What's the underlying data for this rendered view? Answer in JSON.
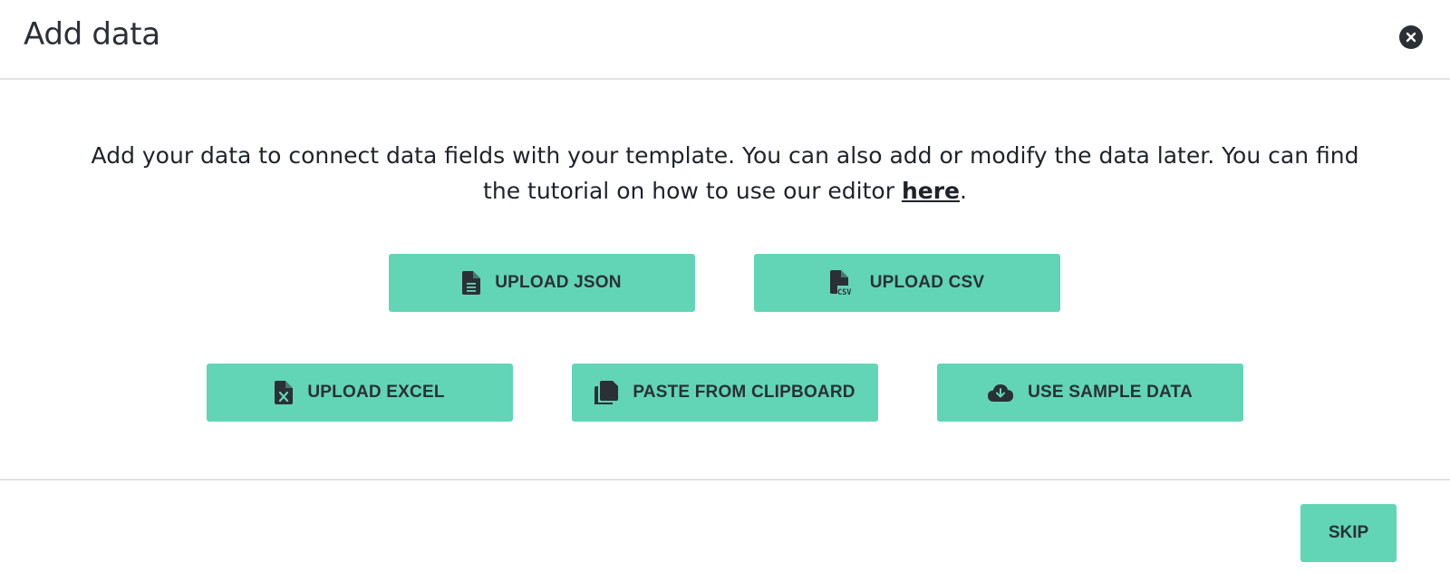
{
  "dialog": {
    "title": "Add data",
    "close_icon": "close-icon"
  },
  "description": {
    "text": "Add your data to connect data fields with your template. You can also add or modify the data later. You can find the tutorial on how to use our editor ",
    "link_text": "here",
    "suffix": "."
  },
  "buttons": {
    "upload_json": {
      "label": "UPLOAD JSON",
      "icon": "file-json-icon"
    },
    "upload_csv": {
      "label": "UPLOAD CSV",
      "icon": "file-csv-icon"
    },
    "upload_excel": {
      "label": "UPLOAD EXCEL",
      "icon": "file-excel-icon"
    },
    "paste_clipboard": {
      "label": "PASTE FROM CLIPBOARD",
      "icon": "clipboard-icon"
    },
    "sample_data": {
      "label": "USE SAMPLE DATA",
      "icon": "cloud-download-icon"
    }
  },
  "footer": {
    "skip_label": "SKIP"
  },
  "colors": {
    "accent": "#61d5b6",
    "text": "#2b3036",
    "divider": "#e1e3e6"
  }
}
